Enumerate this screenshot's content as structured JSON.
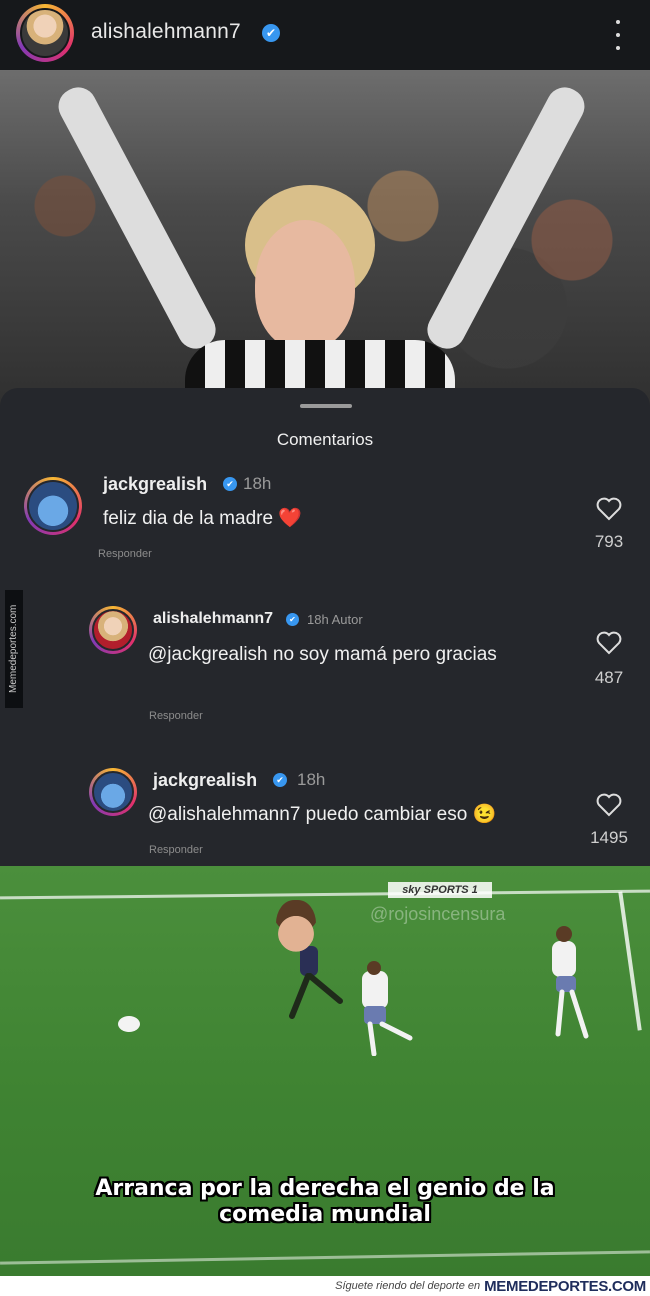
{
  "header": {
    "username": "alishalehmann7",
    "verified_icon": "✔",
    "more_icon": "more-vertical-icon"
  },
  "sheet": {
    "title": "Comentarios"
  },
  "comments": [
    {
      "username": "jackgrealish",
      "time": "18h",
      "text": "feliz dia de la madre",
      "emoji": "❤️",
      "reply_label": "Responder",
      "likes": "793"
    },
    {
      "username": "alishalehmann7",
      "time": "18h Autor",
      "text": "@jackgrealish no soy mamá pero gracias",
      "reply_label": "Responder",
      "likes": "487"
    },
    {
      "username": "jackgrealish",
      "time": "18h",
      "text": "@alishalehmann7 puedo cambiar eso",
      "emoji": "😉",
      "reply_label": "Responder",
      "likes": "1495"
    }
  ],
  "side_credit": "Memedeportes.com",
  "scene": {
    "broadcaster": "sky SPORTS 1",
    "watermark": "@rojosincensura",
    "caption": "Arranca por la derecha el genio de la comedia mundial"
  },
  "footer": {
    "text": "Síguete riendo del deporte en",
    "brand": "MEMEDEPORTES.COM"
  },
  "colors": {
    "sheet_bg": "#25272c",
    "verified": "#3897f0",
    "pitch": "#4b8f3c"
  }
}
